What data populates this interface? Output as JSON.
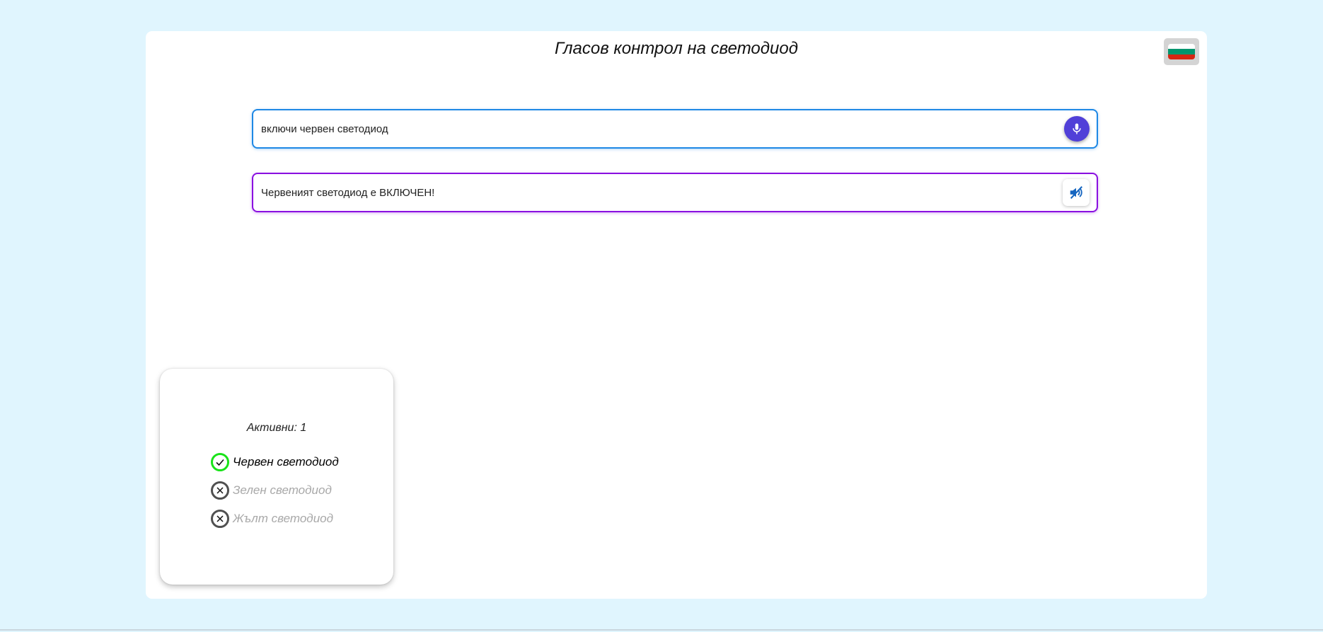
{
  "header": {
    "title": "Гласов контрол на светодиод",
    "language_flag_icon": "bulgarian-flag-icon",
    "flag_colors": [
      "#ffffff",
      "#00966e",
      "#d62612"
    ]
  },
  "command": {
    "value": "включи червен светодиод",
    "mic_icon": "microphone-icon"
  },
  "response": {
    "value": "Червеният светодиод е ВКЛЮЧЕН!",
    "mute_icon": "speaker-muted-icon"
  },
  "status": {
    "active_label": "Активни: 1",
    "leds": [
      {
        "label": "Червен светодиод",
        "state": "on",
        "icon": "check-icon"
      },
      {
        "label": "Зелен светодиод",
        "state": "off",
        "icon": "close-icon"
      },
      {
        "label": "Жълт светодиод",
        "state": "off",
        "icon": "close-icon"
      }
    ]
  },
  "colors": {
    "page_background": "#e0f5fe",
    "command_border": "#1e88e5",
    "response_border": "#8a10e0",
    "mic_button": "#5140d8",
    "led_on": "#19e319",
    "led_off": "#505050"
  }
}
